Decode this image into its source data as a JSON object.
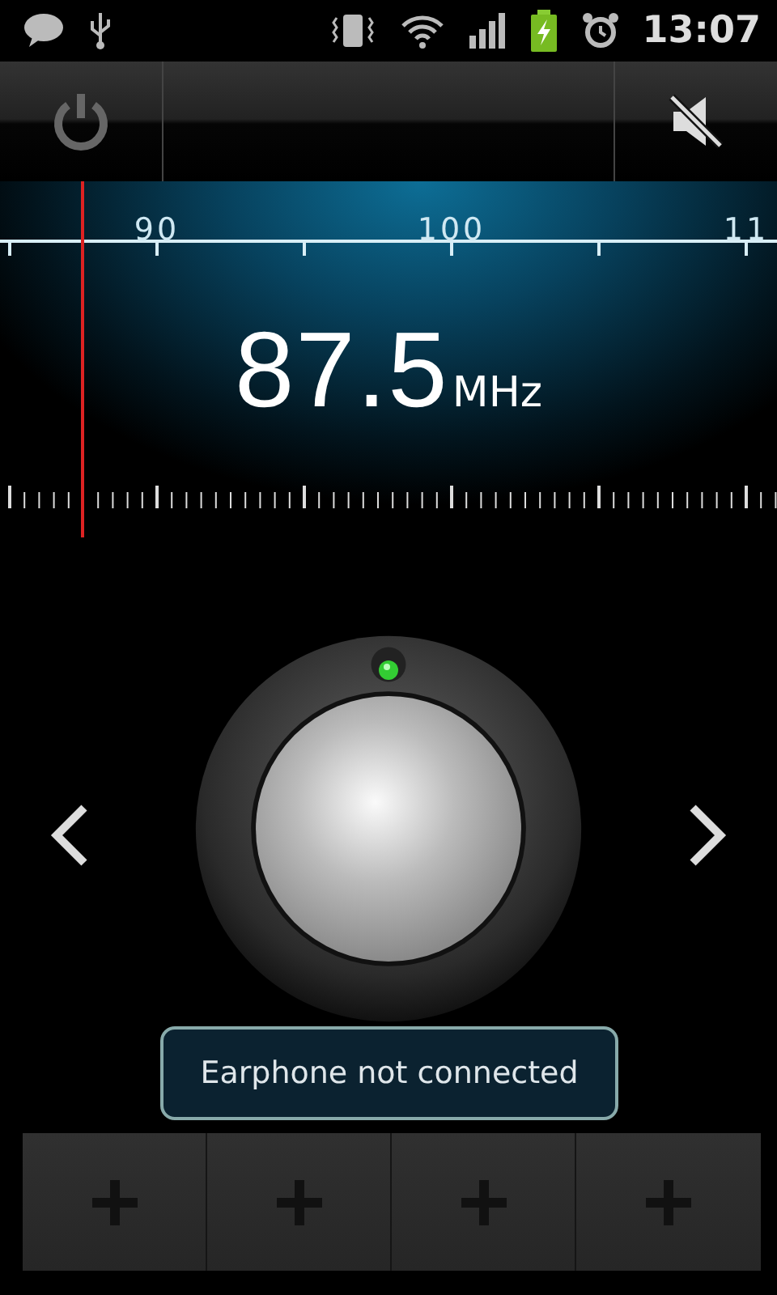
{
  "status_bar": {
    "time": "13:07"
  },
  "toolbar": {
    "muted": true
  },
  "dial": {
    "labels": [
      "90",
      "100",
      "11"
    ],
    "level": 0.106,
    "frequency": "87.5",
    "unit": "MHz"
  },
  "tuner": {
    "lit": true
  },
  "toast": {
    "text": "Earphone not connected"
  },
  "presets": [
    {
      "kind": "empty"
    },
    {
      "kind": "empty"
    },
    {
      "kind": "empty"
    },
    {
      "kind": "empty"
    }
  ]
}
